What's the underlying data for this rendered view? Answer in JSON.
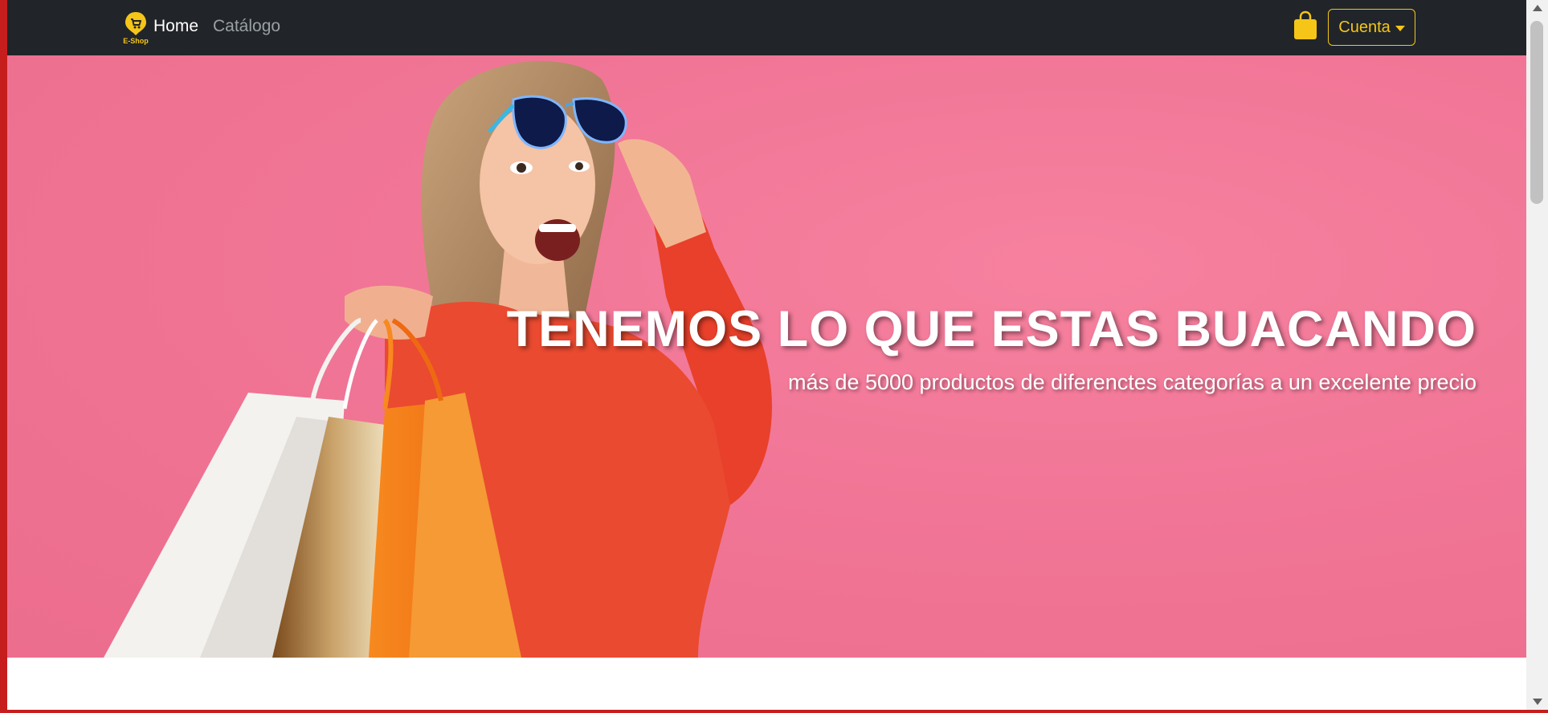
{
  "navbar": {
    "brand_text": "E-Shop",
    "links": [
      {
        "label": "Home"
      },
      {
        "label": "Catálogo"
      }
    ],
    "account_label": "Cuenta"
  },
  "hero": {
    "title": "TENEMOS LO QUE ESTAS BUACANDO",
    "subtitle": "más de 5000 productos de diferenctes categorías a un excelente precio"
  },
  "colors": {
    "navbar_bg": "#212529",
    "accent": "#f5c518",
    "hero_bg": "#f17596"
  },
  "icons": [
    "eshop-logo-icon",
    "shopping-bag-icon",
    "caret-down-icon"
  ]
}
